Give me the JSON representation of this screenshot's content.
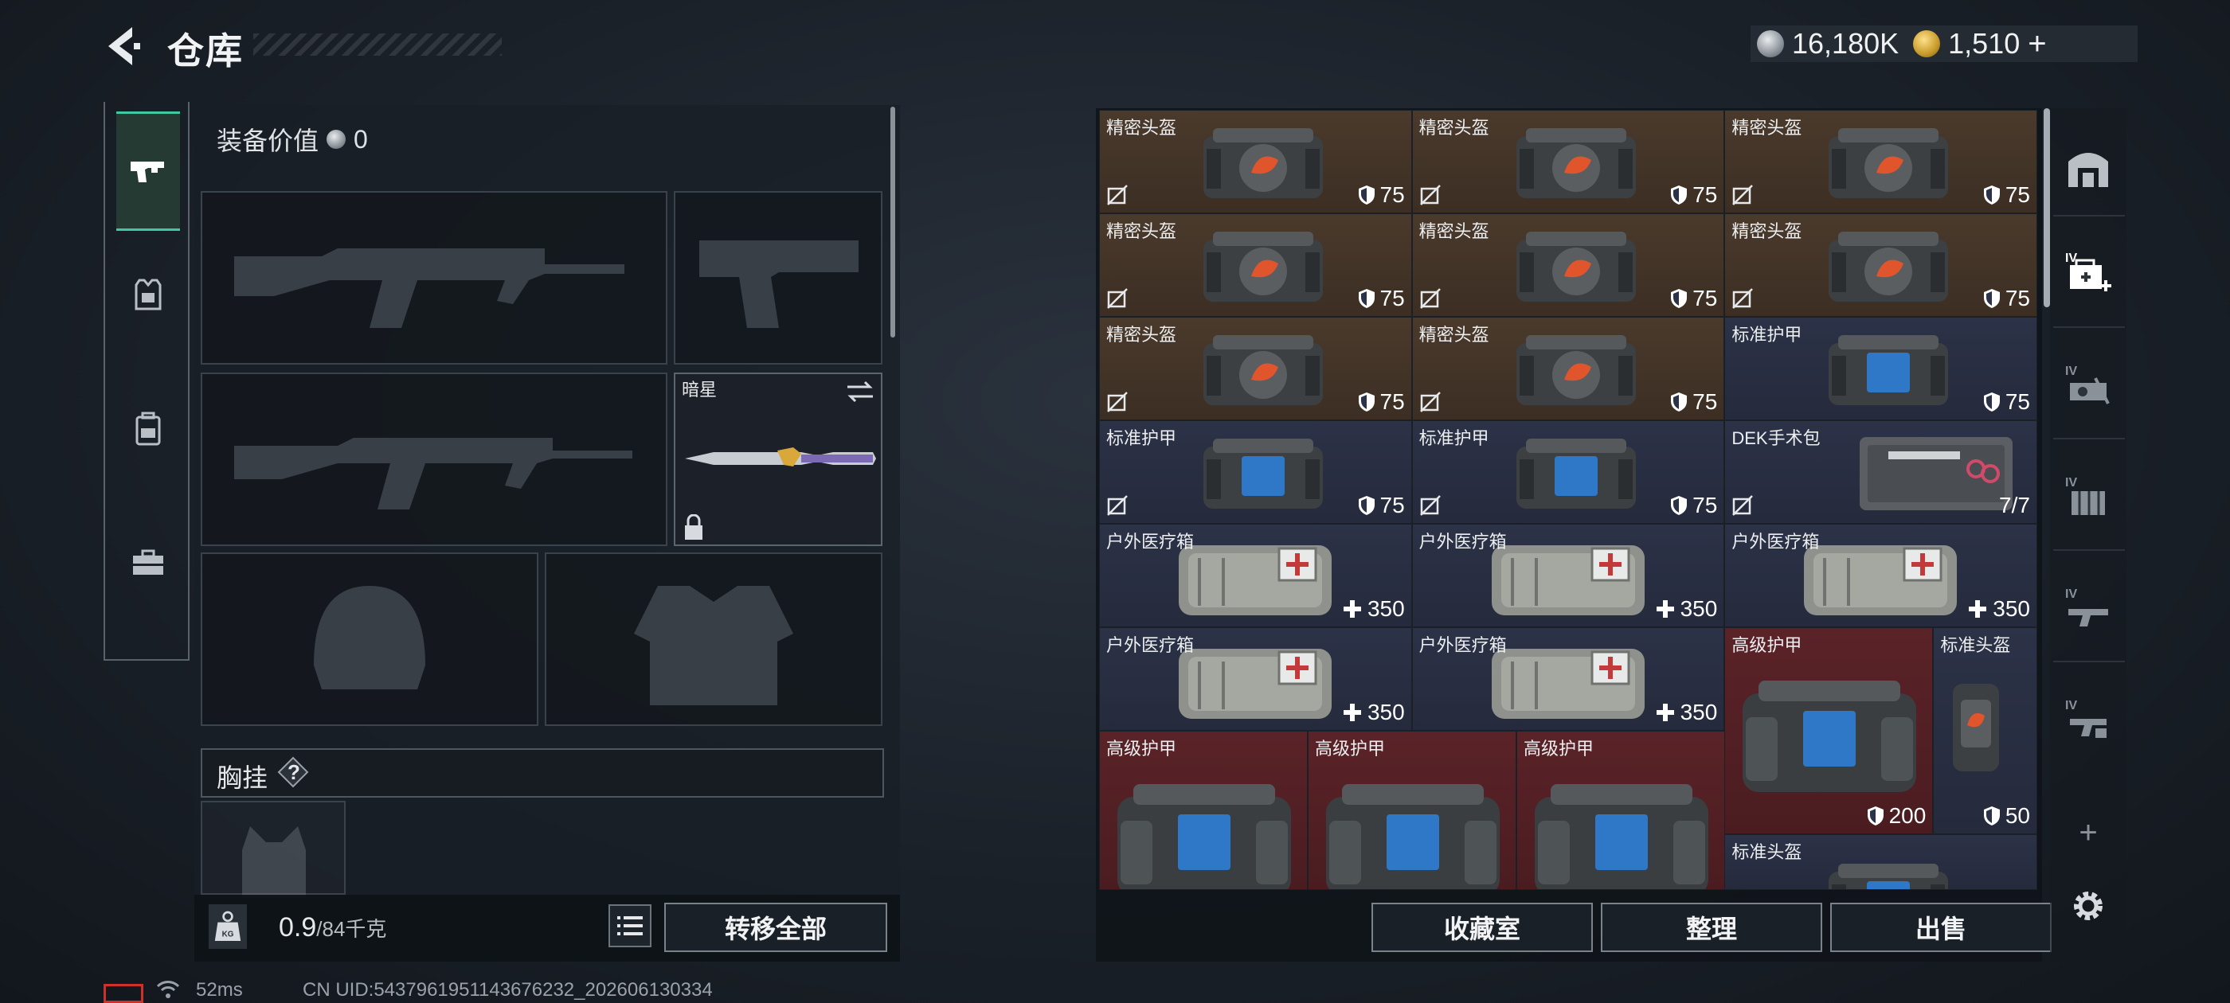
{
  "header": {
    "title": "仓库",
    "currency": [
      {
        "icon": "silver-coin-icon",
        "value": "16,180K"
      },
      {
        "icon": "gold-coin-icon",
        "value": "1,510"
      }
    ],
    "currency_add": "+"
  },
  "left_nav": [
    {
      "name": "nav-weapon",
      "icon": "pistol-icon",
      "active": true
    },
    {
      "name": "nav-armor",
      "icon": "armor-vest-icon",
      "active": false
    },
    {
      "name": "nav-backpack",
      "icon": "backpack-icon",
      "active": false
    },
    {
      "name": "nav-case",
      "icon": "toolbox-icon",
      "active": false
    }
  ],
  "loadout": {
    "equip_value_label": "装备价值",
    "equip_value": "0",
    "melee_name": "暗星",
    "chest_rig_label": "胸挂",
    "help": "?",
    "weight_value": "0.9",
    "weight_max": "/84千克",
    "weight_icon": "KG",
    "transfer_all": "转移全部"
  },
  "storage": {
    "items": [
      {
        "name": "精密头盔",
        "type": "helmet",
        "value": "75",
        "kind": "shield",
        "noins": true,
        "color": "brown"
      },
      {
        "name": "精密头盔",
        "type": "helmet",
        "value": "75",
        "kind": "shield",
        "noins": true,
        "color": "brown"
      },
      {
        "name": "精密头盔",
        "type": "helmet",
        "value": "75",
        "kind": "shield",
        "noins": true,
        "color": "brown"
      },
      {
        "name": "精密头盔",
        "type": "helmet",
        "value": "75",
        "kind": "shield",
        "noins": true,
        "color": "brown"
      },
      {
        "name": "精密头盔",
        "type": "helmet",
        "value": "75",
        "kind": "shield",
        "noins": true,
        "color": "brown"
      },
      {
        "name": "精密头盔",
        "type": "helmet",
        "value": "75",
        "kind": "shield",
        "noins": true,
        "color": "brown"
      },
      {
        "name": "精密头盔",
        "type": "helmet",
        "value": "75",
        "kind": "shield",
        "noins": true,
        "color": "brown"
      },
      {
        "name": "精密头盔",
        "type": "helmet",
        "value": "75",
        "kind": "shield",
        "noins": true,
        "color": "brown"
      },
      {
        "name": "标准护甲",
        "type": "armor",
        "value": "75",
        "kind": "shield",
        "noins": false,
        "color": "navy"
      },
      {
        "name": "标准护甲",
        "type": "armor",
        "value": "75",
        "kind": "shield",
        "noins": true,
        "color": "navy"
      },
      {
        "name": "标准护甲",
        "type": "armor",
        "value": "75",
        "kind": "shield",
        "noins": true,
        "color": "navy"
      },
      {
        "name": "DEK手术包",
        "type": "surgery",
        "value": "7/7",
        "kind": "count",
        "noins": true,
        "color": "navy"
      },
      {
        "name": "户外医疗箱",
        "type": "medkit",
        "value": "350",
        "kind": "heal",
        "noins": false,
        "color": "navy"
      },
      {
        "name": "户外医疗箱",
        "type": "medkit",
        "value": "350",
        "kind": "heal",
        "noins": false,
        "color": "navy"
      },
      {
        "name": "户外医疗箱",
        "type": "medkit",
        "value": "350",
        "kind": "heal",
        "noins": false,
        "color": "navy"
      },
      {
        "name": "户外医疗箱",
        "type": "medkit",
        "value": "350",
        "kind": "heal",
        "noins": false,
        "color": "navy"
      },
      {
        "name": "户外医疗箱",
        "type": "medkit",
        "value": "350",
        "kind": "heal",
        "noins": false,
        "color": "navy"
      },
      {
        "name": "高级护甲",
        "type": "bigarmor",
        "value": "200",
        "kind": "shield",
        "noins": false,
        "color": "red"
      },
      {
        "name": "标准头盔",
        "type": "smallhelmet",
        "value": "50",
        "kind": "shield",
        "noins": false,
        "color": "navy"
      },
      {
        "name": "高级护甲",
        "type": "bigarmor",
        "value": "",
        "kind": "none",
        "noins": false,
        "color": "red"
      },
      {
        "name": "高级护甲",
        "type": "bigarmor",
        "value": "",
        "kind": "none",
        "noins": false,
        "color": "red"
      },
      {
        "name": "高级护甲",
        "type": "bigarmor",
        "value": "",
        "kind": "none",
        "noins": false,
        "color": "red"
      },
      {
        "name": "标准头盔",
        "type": "armor",
        "value": "",
        "kind": "none",
        "noins": false,
        "color": "navy"
      }
    ],
    "buttons": {
      "collection": "收藏室",
      "sort": "整理",
      "sell": "出售"
    }
  },
  "right_nav": [
    {
      "name": "safe-room-icon"
    },
    {
      "name": "medical-level4-icon",
      "tier": "IV",
      "active": true
    },
    {
      "name": "workbench-level4-icon",
      "tier": "IV"
    },
    {
      "name": "storage-level4-icon",
      "tier": "IV"
    },
    {
      "name": "weapon-bench-level4-icon",
      "tier": "IV"
    },
    {
      "name": "armor-bench-level4-icon",
      "tier": "IV"
    }
  ],
  "right_nav_add": "+",
  "status": {
    "ping": "52ms",
    "uid": "CN UID:5437961951143676232_202606130334"
  },
  "colors": {
    "accent": "#3fc9a3",
    "brown_cell": "#4a3a2c",
    "navy_cell": "#2c3247",
    "red_cell": "#5a2328",
    "battery": "#d0302a"
  }
}
